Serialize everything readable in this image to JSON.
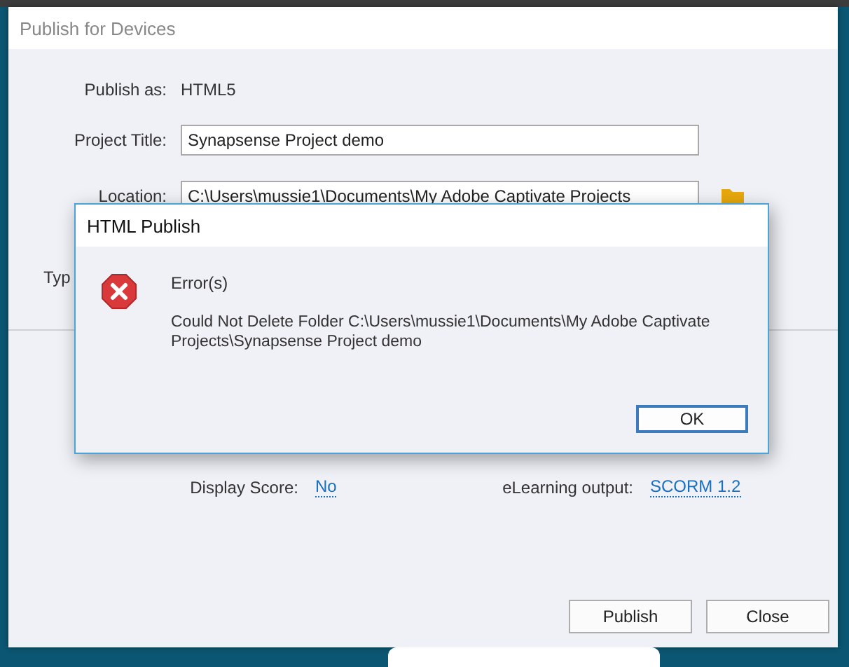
{
  "window": {
    "title": "Publish for Devices"
  },
  "form": {
    "publish_as_label": "Publish as:",
    "publish_as": "HTML5",
    "project_title_label": "Project Title:",
    "project_title": "Synapsense Project demo",
    "location_label": "Location:",
    "location": "C:\\Users\\mussie1\\Documents\\My Adobe Captivate Projects",
    "type_label": "Typ"
  },
  "settings": [
    {
      "label": "Display Score:",
      "value": "No"
    },
    {
      "label": "eLearning output:",
      "value": "SCORM 1.2"
    }
  ],
  "buttons": [
    "Publish",
    "Close"
  ],
  "dialog": {
    "title": "HTML Publish",
    "heading": "Error(s)",
    "message": "Could Not Delete Folder C:\\Users\\mussie1\\Documents\\My Adobe Captivate Projects\\Synapsense Project demo",
    "button": "OK"
  }
}
